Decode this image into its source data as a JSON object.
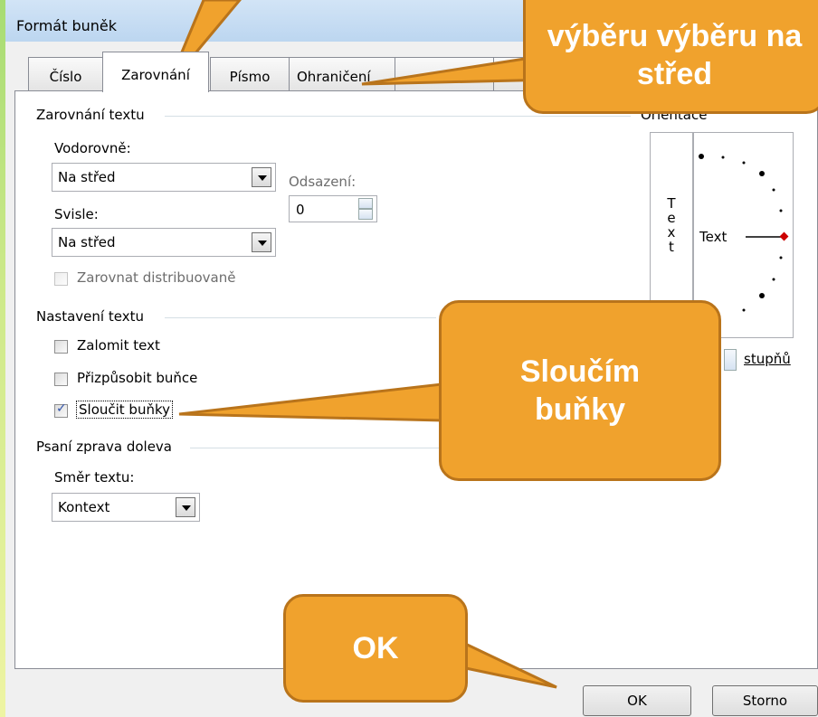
{
  "dialog": {
    "title": "Formát buněk"
  },
  "tabs": [
    {
      "label": "Číslo"
    },
    {
      "label": "Zarovnání"
    },
    {
      "label": "Písmo"
    },
    {
      "label": "Ohraničení"
    }
  ],
  "text_alignment": {
    "group_label": "Zarovnání textu",
    "horizontal_label": "Vodorovně:",
    "horizontal_value": "Na střed",
    "indent_label": "Odsazení:",
    "indent_value": "0",
    "vertical_label": "Svisle:",
    "vertical_value": "Na střed",
    "distributed_label": "Zarovnat distribuovaně"
  },
  "text_control": {
    "group_label": "Nastavení textu",
    "wrap_label": "Zalomit text",
    "shrink_label": "Přizpůsobit buňce",
    "merge_label": "Sloučit buňky",
    "merge_checked": true
  },
  "rtl": {
    "group_label": "Psaní zprava doleva",
    "direction_label": "Směr textu:",
    "direction_value": "Kontext"
  },
  "orientation": {
    "group_label": "Orientace",
    "vertical_text": "T e x t",
    "dial_text": "Text",
    "degrees_label": "stupňů"
  },
  "buttons": {
    "ok": "OK",
    "cancel": "Storno"
  },
  "callouts": {
    "top": "výběru výběru na střed",
    "merge": "Sloučím buňky",
    "ok": "OK"
  },
  "colors": {
    "callout_fill": "#f0a22d",
    "callout_border": "#b9741b"
  }
}
